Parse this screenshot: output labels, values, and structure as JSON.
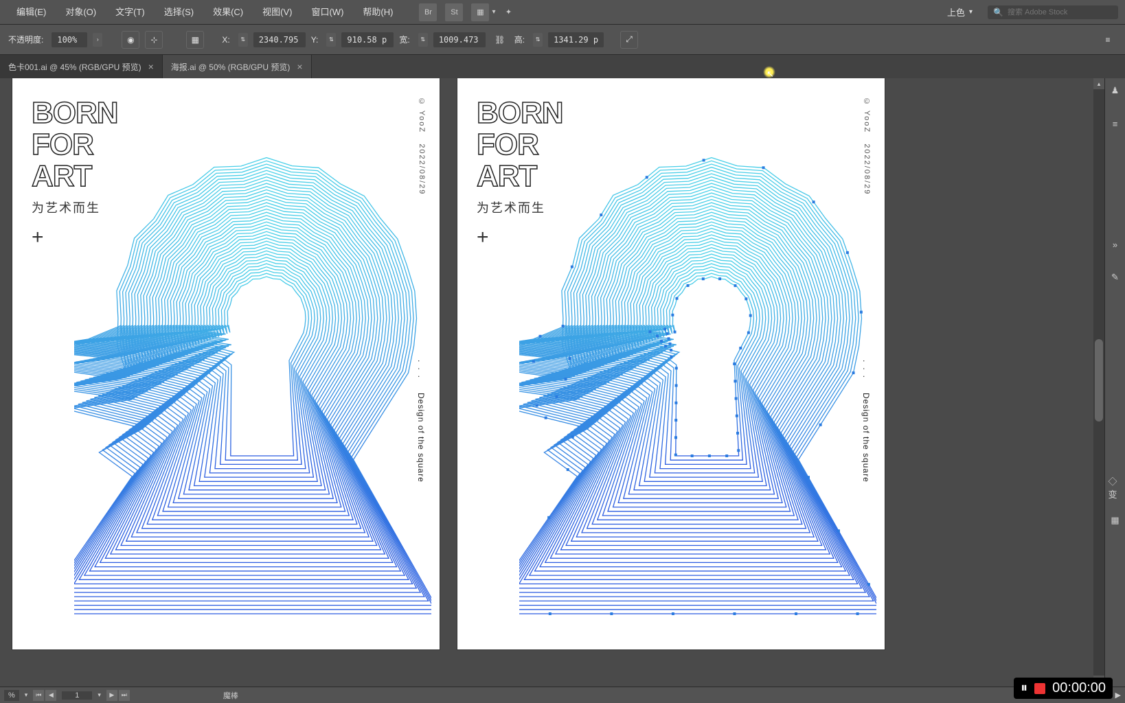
{
  "menu": {
    "edit": "编辑(E)",
    "object": "对象(O)",
    "text": "文字(T)",
    "select": "选择(S)",
    "effect": "效果(C)",
    "view": "视图(V)",
    "window": "窗口(W)",
    "help": "帮助(H)",
    "workspace": "上色",
    "search_ph": "搜索 Adobe Stock"
  },
  "opt": {
    "opacity_lbl": "不透明度:",
    "opacity_val": "100%",
    "x_lbl": "X:",
    "x_val": "2340.795",
    "y_lbl": "Y:",
    "y_val": "910.58 p",
    "w_lbl": "宽:",
    "w_val": "1009.473",
    "h_lbl": "高:",
    "h_val": "1341.29 p"
  },
  "tabs": [
    {
      "label": "色卡001.ai @ 45% (RGB/GPU 预览)"
    },
    {
      "label": "海报.ai @ 50% (RGB/GPU 预览)"
    }
  ],
  "art": {
    "title1": "BORN",
    "title2": "FOR",
    "title3": "ART",
    "sub": "为艺术而生",
    "plus": "+",
    "copyright": "© YooZ",
    "date": "2022/08/29",
    "design": "Design of the square",
    "dots": "..."
  },
  "status": {
    "zoom": "%",
    "page": "1",
    "tool": "魔棒"
  },
  "rec": {
    "time": "00:00:00"
  }
}
